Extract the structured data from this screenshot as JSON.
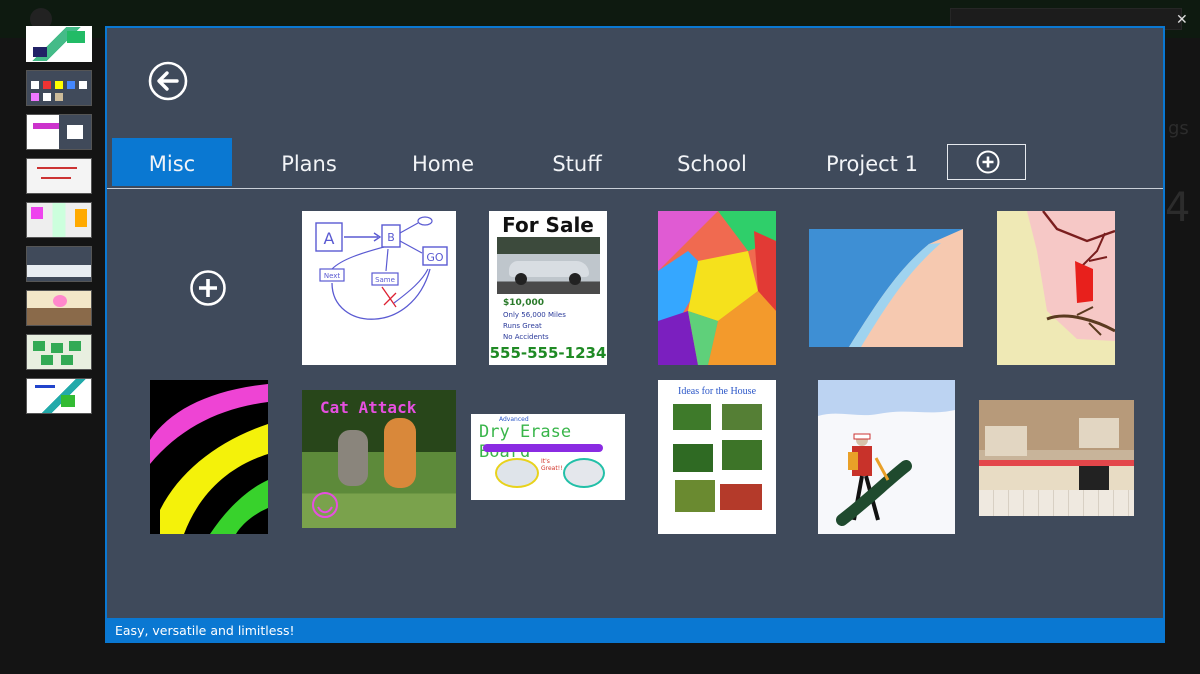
{
  "window": {
    "tabs": [
      {
        "label": "Misc",
        "active": true
      },
      {
        "label": "Plans",
        "active": false
      },
      {
        "label": "Home",
        "active": false
      },
      {
        "label": "Stuff",
        "active": false
      },
      {
        "label": "School",
        "active": false
      },
      {
        "label": "Project 1",
        "active": false
      }
    ],
    "status_text": "Easy, versatile and limitless!"
  },
  "tiles": {
    "for_sale": {
      "title": "For Sale",
      "price": "$10,000",
      "line1": "Only 56,000 Miles",
      "line2": "Runs Great",
      "line3": "No Accidents",
      "phone": "555-555-1234"
    },
    "flowchart": {
      "a": "A",
      "b": "B",
      "go": "GO",
      "next": "Next",
      "same": "Same"
    },
    "cat": {
      "caption": "Cat Attack"
    },
    "board": {
      "small": "Advanced",
      "title": "Dry Erase Board",
      "note": "It's Great!!"
    },
    "house": {
      "title": "Ideas for the House"
    }
  },
  "icons": {
    "back": "back-arrow-circle-icon",
    "add_tab": "plus-circle-icon",
    "new_page": "plus-circle-icon",
    "close": "close-icon"
  },
  "colors": {
    "accent": "#0a78d2",
    "panel": "#3f4a5b"
  }
}
